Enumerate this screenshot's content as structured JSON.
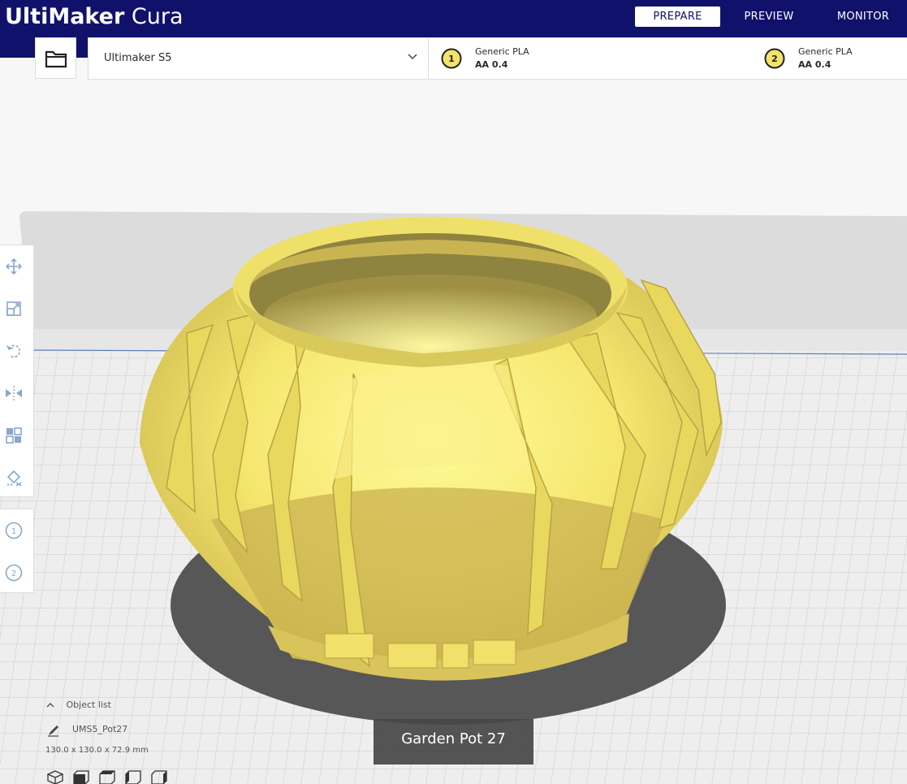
{
  "header": {
    "logo_brand": "UltiMaker",
    "logo_product": "Cura",
    "stages": [
      "PREPARE",
      "PREVIEW",
      "MONITOR"
    ],
    "active_stage": "PREPARE"
  },
  "toolbar": {
    "open_file_icon": "folder-icon",
    "printer_name": "Ultimaker S5",
    "extruders": [
      {
        "number": "1",
        "material": "Generic PLA",
        "nozzle": "AA 0.4"
      },
      {
        "number": "2",
        "material": "Generic PLA",
        "nozzle": "AA 0.4"
      }
    ]
  },
  "tools": [
    "move-icon",
    "scale-icon",
    "rotate-icon",
    "mirror-icon",
    "per-model-settings-icon",
    "support-blocker-icon"
  ],
  "extruder_tools": [
    "1",
    "2"
  ],
  "object_list": {
    "title": "Object list",
    "item_name": "UMS5_Pot27",
    "dimensions": "130.0 x 130.0 x 72.9 mm"
  },
  "view_icons": [
    "3d-view-icon",
    "front-view-icon",
    "top-view-icon",
    "left-view-icon",
    "right-view-icon"
  ],
  "tooltip": "Garden Pot 27",
  "colors": {
    "header": "#10116b",
    "model": "#f3e36c",
    "model_shade": "#c9b44a",
    "shadow": "#5b5b5b",
    "plate_grid": "#c4c4c4"
  }
}
